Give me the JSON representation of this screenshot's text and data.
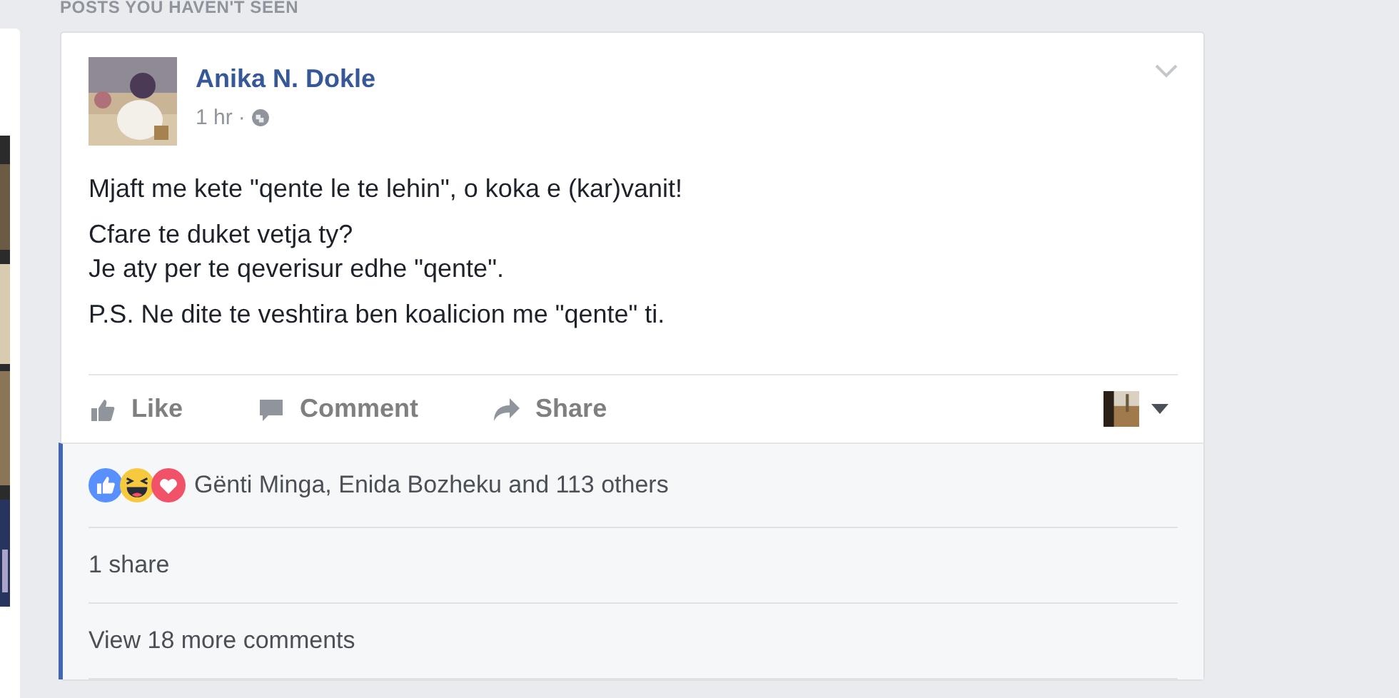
{
  "section_heading": "POSTS YOU HAVEN'T SEEN",
  "post": {
    "author": "Anika N. Dokle",
    "time": "1 hr",
    "separator": "·",
    "paragraphs": [
      "Mjaft me kete \"qente le te lehin\", o koka e (kar)vanit!",
      "Cfare te duket vetja ty?\nJe aty per te qeverisur edhe \"qente\".",
      "P.S. Ne dite te veshtira ben koalicion me \"qente\" ti."
    ],
    "actions": [
      {
        "kind": "like",
        "label": "Like"
      },
      {
        "kind": "comment",
        "label": "Comment"
      },
      {
        "kind": "share",
        "label": "Share"
      }
    ],
    "reactions": {
      "icons": [
        {
          "kind": "like"
        },
        {
          "kind": "haha"
        },
        {
          "kind": "love"
        }
      ],
      "text": "Gënti Minga, Enida Bozheku and 113 others"
    },
    "shares": "1 share",
    "more_comments": "View 18 more comments"
  }
}
